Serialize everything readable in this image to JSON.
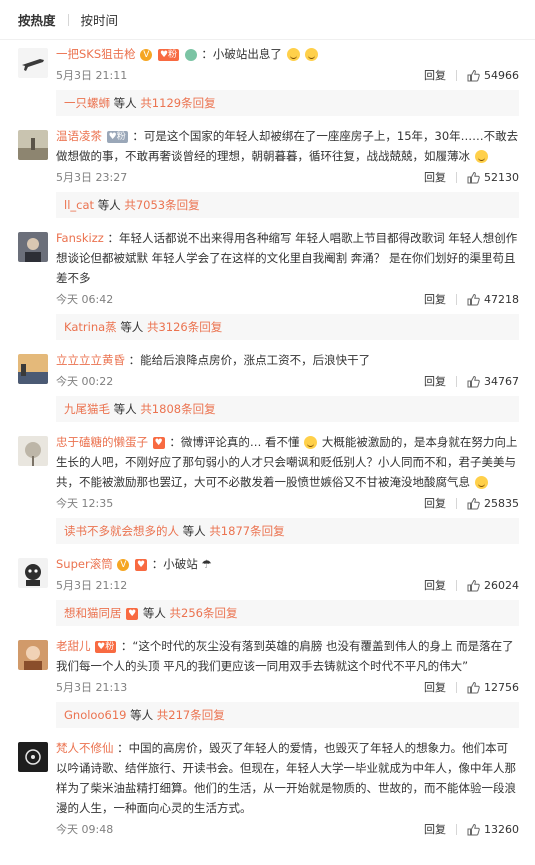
{
  "tabs": {
    "hot": "按热度",
    "time": "按时间"
  },
  "reply_label": "回复",
  "others_label": "等人",
  "comments": [
    {
      "user": "一把SKS狙击枪",
      "text": "：小破站出息了",
      "time": "5月3日 21:11",
      "likes": "54966",
      "sub_user": "一只螺蛳",
      "sub_more": "共1129条回复"
    },
    {
      "user": "温语凌茶",
      "text": "：可是这个国家的年轻人却被绑在了一座座房子上，15年，30年……不敢去做想做的事，不敢再奢谈曾经的理想，朝朝暮暮，循环往复，战战兢兢，如履薄冰",
      "time": "5月3日 23:27",
      "likes": "52130",
      "sub_user": "ll_cat",
      "sub_more": "共7053条回复"
    },
    {
      "user": "Fanskizz",
      "text": "：年轻人话都说不出来得用各种缩写  年轻人唱歌上节目都得改歌词 年轻人想创作想谈论但都被斌默  年轻人学会了在这样的文化里自我阉割  奔涌？ 是在你们划好的渠里苟且差不多",
      "time": "今天 06:42",
      "likes": "47218",
      "sub_user": "Katrina蒸",
      "sub_more": "共3126条回复"
    },
    {
      "user": "立立立立黄昏",
      "text": "：能给后浪降点房价，涨点工资不，后浪快干了",
      "time": "今天 00:22",
      "likes": "34767",
      "sub_user": "九尾猫毛",
      "sub_more": "共1808条回复"
    },
    {
      "user": "忠于磕糖的懒蛋子",
      "text_a": "：微博评论真的…  看不懂",
      "text_b": " 大概能被激励的，是本身就在努力向上生长的人吧，不刚好应了那句弱小的人才只会嘲讽和贬低别人？小人同而不和，君子美美与共，不能被激励那也罢辽，大可不必散发着一股愤世嫉俗又不甘被淹没地酸腐气息",
      "time": "今天 12:35",
      "likes": "25835",
      "sub_user": "读书不多就会想多的人",
      "sub_more": "共1877条回复"
    },
    {
      "user": "Super滚筒",
      "text": "：小破站",
      "time": "5月3日 21:12",
      "likes": "26024",
      "sub_user": "想和猫同居",
      "sub_more": "共256条回复"
    },
    {
      "user": "老甜儿",
      "text": "：“这个时代的灰尘没有落到英雄的肩膀 也没有覆盖到伟人的身上 而是落在了我们每一个人的头顶 平凡的我们更应该一同用双手去铸就这个时代不平凡的伟大”",
      "time": "5月3日 21:13",
      "likes": "12756",
      "sub_user": "Gnoloo619",
      "sub_more": "共217条回复"
    },
    {
      "user": "梵人不修仙",
      "text": "：中国的高房价，毁灭了年轻人的爱情，也毁灭了年轻人的想象力。他们本可以吟诵诗歌、结伴旅行、开读书会。但现在，年轻人大学一毕业就成为中年人，像中年人那样为了柴米油盐精打细算。他们的生活，从一开始就是物质的、世故的，而不能体验一段浪漫的人生，一种面向心灵的生活方式。",
      "time": "今天 09:48",
      "likes": "13260"
    }
  ]
}
